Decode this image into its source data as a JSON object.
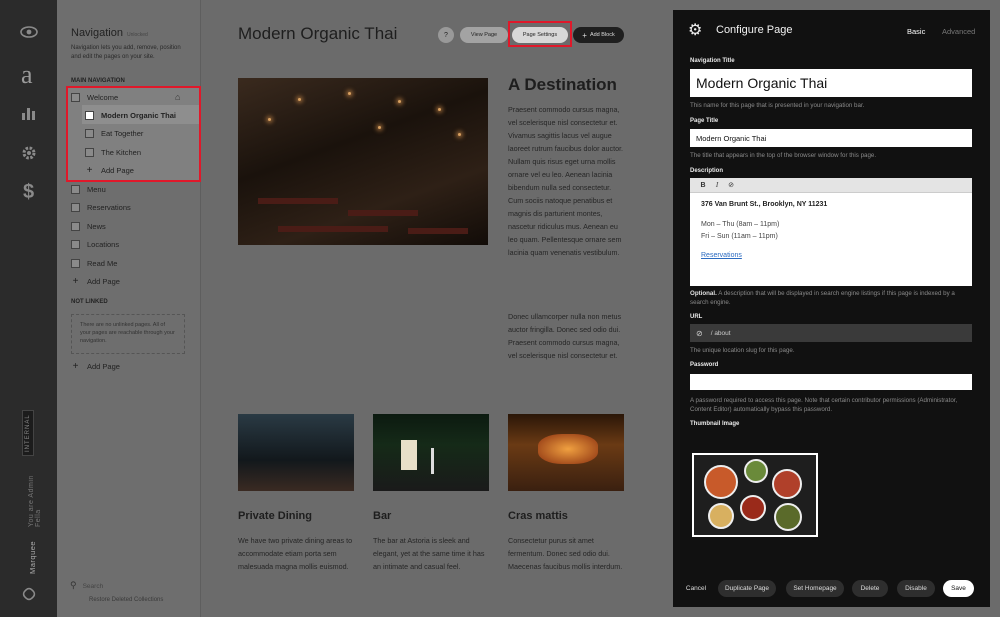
{
  "rail": {
    "brand": "a",
    "badge": "INTERNAL",
    "vertical_text": "You are Admin Fella",
    "product": "Marquee"
  },
  "nav": {
    "title": "Navigation",
    "title_note": "Unlocked",
    "description": "Navigation lets you add, remove, position and edit the pages on your site.",
    "main_label": "MAIN NAVIGATION",
    "items_top": [
      {
        "label": "Welcome"
      },
      {
        "label": "Modern Organic Thai"
      },
      {
        "label": "Eat Together"
      },
      {
        "label": "The Kitchen"
      },
      {
        "label": "Add Page"
      }
    ],
    "items": [
      {
        "label": "Menu"
      },
      {
        "label": "Reservations"
      },
      {
        "label": "News"
      },
      {
        "label": "Locations"
      },
      {
        "label": "Read Me"
      },
      {
        "label": "Add Page"
      }
    ],
    "unlinked_label": "NOT LINKED",
    "unlinked_text": "There are no unlinked pages. All of your pages are reachable through your navigation.",
    "unlinked_add": "Add Page",
    "search_placeholder": "Search",
    "restore": "Restore Deleted Collections"
  },
  "page": {
    "title": "Modern Organic Thai",
    "toolbar": {
      "help": "?",
      "view": "View Page",
      "settings": "Page Settings",
      "add": "Add Block"
    },
    "heading": "A Destination",
    "para1": "Praesent commodo cursus magna, vel scelerisque nisl consectetur et. Vivamus sagittis lacus vel augue laoreet rutrum faucibus dolor auctor. Nullam quis risus eget urna mollis ornare vel eu leo. Aenean lacinia bibendum nulla sed consectetur. Cum sociis natoque penatibus et magnis dis parturient montes, nascetur ridiculus mus. Aenean eu leo quam. Pellentesque ornare sem lacinia quam venenatis vestibulum.",
    "para2": "Donec ullamcorper nulla non metus auctor fringilla. Donec sed odio dui. Praesent commodo cursus magna, vel scelerisque nisl consectetur et.",
    "columns": [
      {
        "heading": "Private Dining",
        "text": "We have two private dining areas to accommodate etiam porta sem malesuada magna mollis euismod."
      },
      {
        "heading": "Bar",
        "text": "The bar at Astoria is sleek and elegant, yet at the same time it has an intimate and casual feel."
      },
      {
        "heading": "Cras mattis",
        "text": "Consectetur purus sit amet fermentum. Donec sed odio dui. Maecenas faucibus mollis interdum."
      }
    ]
  },
  "config": {
    "title": "Configure Page",
    "tab_basic": "Basic",
    "tab_advanced": "Advanced",
    "nav_title_label": "Navigation Title",
    "nav_title_value": "Modern Organic Thai",
    "nav_title_help": "This name for this page that is presented in your navigation bar.",
    "page_title_label": "Page Title",
    "page_title_value": "Modern Organic Thai",
    "page_title_help": "The title that appears in the top of the browser window for this page.",
    "description_label": "Description",
    "toolbar": {
      "bold": "B",
      "italic": "I",
      "link": "⊘"
    },
    "desc_address": "376 Van Brunt St., Brooklyn, NY 11231",
    "desc_hours1": "Mon – Thu (8am – 11pm)",
    "desc_hours2": "Fri – Sun (11am – 11pm)",
    "desc_link": "Reservations",
    "desc_optional": "Optional.",
    "desc_help": " A description that will be displayed in search engine listings if this page is indexed by a search engine.",
    "url_label": "URL",
    "url_value": "/ about",
    "url_help": "The unique location slug for this page.",
    "password_label": "Password",
    "password_help": "A password required to access this page. Note that certain contributor permissions (Administrator, Content Editor) automatically bypass this password.",
    "thumbnail_label": "Thumbnail Image",
    "buttons": {
      "cancel": "Cancel",
      "duplicate": "Duplicate Page",
      "homepage": "Set Homepage",
      "delete": "Delete",
      "disable": "Disable",
      "save": "Save"
    }
  },
  "colors": {
    "highlight": "#e0182a",
    "panel": "#111111",
    "link": "#2a6ac0"
  }
}
